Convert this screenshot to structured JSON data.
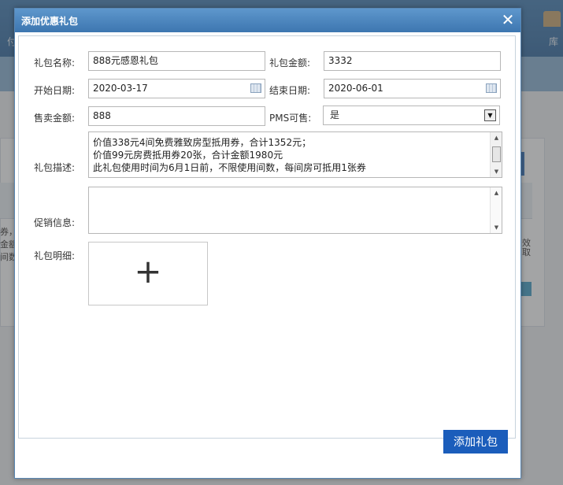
{
  "background": {
    "nav_label_right": "库",
    "nav_label_left": "付",
    "frags": [
      "券，",
      "金额",
      "间数",
      "效",
      "取"
    ]
  },
  "dialog": {
    "title": "添加优惠礼包",
    "close_icon": "close-icon",
    "form": {
      "name_label": "礼包名称:",
      "name_value": "888元感恩礼包",
      "amount_label": "礼包金额:",
      "amount_value": "3332",
      "start_label": "开始日期:",
      "start_value": "2020-03-17",
      "end_label": "结束日期:",
      "end_value": "2020-06-01",
      "sale_label": "售卖金额:",
      "sale_value": "888",
      "pms_label": "PMS可售:",
      "pms_value": "是",
      "desc_label": "礼包描述:",
      "desc_lines": [
        "价值338元4间免费雅致房型抵用券，合计1352元；",
        "价值99元房费抵用券20张，合计金额1980元",
        "此礼包使用时间为6月1日前，不限使用间数，每间房可抵用1张券"
      ],
      "promo_label": "促销信息:",
      "promo_value": "",
      "detail_label": "礼包明细:",
      "add_icon": "plus-icon"
    },
    "submit_label": "添加礼包"
  }
}
